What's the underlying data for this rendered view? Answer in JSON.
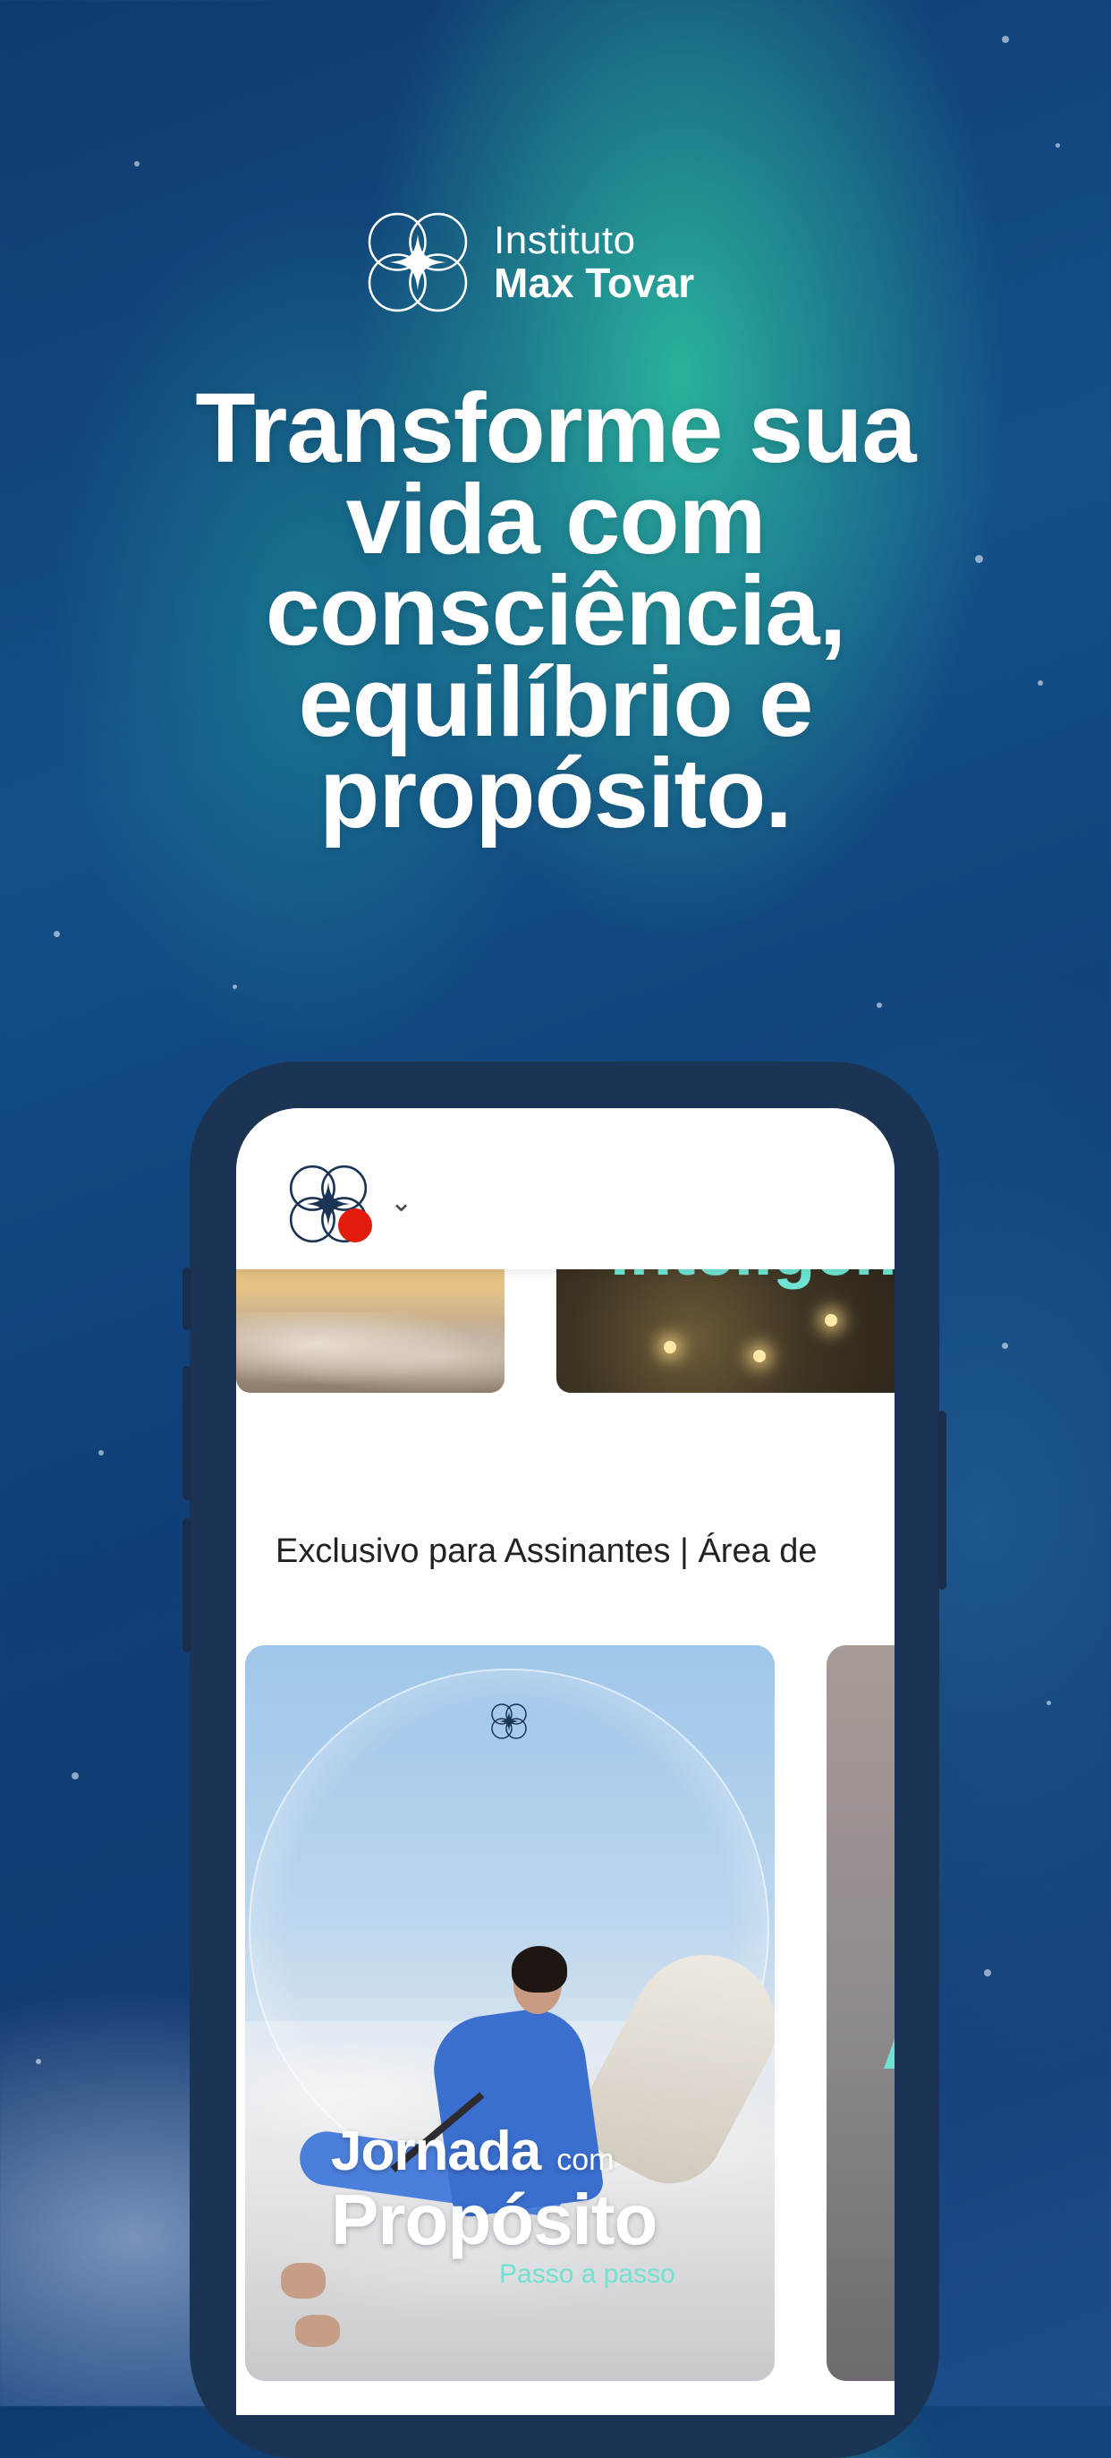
{
  "brand": {
    "line1": "Instituto",
    "line2": "Max Tovar",
    "icon": "flower-star-logo"
  },
  "headline": {
    "line1": "Transforme sua",
    "line2": "vida com",
    "line3": "consciência,",
    "line4": "equilíbrio e",
    "line5": "propósito."
  },
  "app": {
    "header": {
      "logo_icon": "flower-star-logo",
      "notification_color": "#e31b0c",
      "dropdown_icon": "chevron-down-icon"
    },
    "carousel_top": {
      "tile2_title": "Inteligên"
    },
    "section_title": "Exclusivo para Assinantes | Área de",
    "cards": [
      {
        "title_word1": "Jornada",
        "title_word2": "com",
        "title_word3": "Propósito",
        "subtitle": "Passo a passo"
      },
      {
        "partial_letter": "A"
      }
    ]
  },
  "colors": {
    "accent_teal": "#6fe3d2",
    "phone_frame": "#1b3454",
    "notch_detail": "#1f7fc6"
  }
}
